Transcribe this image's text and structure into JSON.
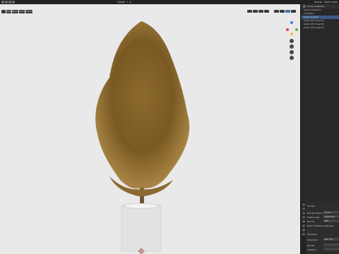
{
  "topbar": {
    "workspace_label": "Scene",
    "mode_label": "Object Mode",
    "right_label": "View Layer",
    "menu": [
      "File",
      "Edit",
      "Render",
      "Window",
      "Help"
    ]
  },
  "viewport": {
    "header_items": [
      "View",
      "Select",
      "Add",
      "Object"
    ],
    "shading_label": "Global"
  },
  "outliner": {
    "title": "Scene Collection",
    "rows": [
      {
        "label": "Scene Collection",
        "selected": false
      },
      {
        "label": "Collection",
        "selected": false
      },
      {
        "label": "Camera.plant",
        "selected": true
      },
      {
        "label": "plant_105_Flag_th1",
        "selected": false
      },
      {
        "label": "plant_105_Flag_th2",
        "selected": false
      },
      {
        "label": "plant_105_Flag_rnd",
        "selected": false
      }
    ]
  },
  "properties": {
    "section": "Format",
    "rows": [
      {
        "label": "Render Engine",
        "value": "Cycles"
      },
      {
        "label": "Feature Set",
        "value": "Supported"
      },
      {
        "label": "Device",
        "value": "GPU"
      },
      {
        "label": "Open Shading Language",
        "value": ""
      },
      {
        "label": "Sampling",
        "value": ""
      },
      {
        "label": "Integrator",
        "value": "Path Trac"
      },
      {
        "label": "Render",
        "value": ""
      },
      {
        "label": "Viewport",
        "value": ""
      }
    ]
  },
  "colors": {
    "viewport_bg": "#e9e9e9",
    "leaf_dark": "#6b4e1f",
    "leaf_light": "#a9803f",
    "pot": "#e2e2e2",
    "selection": "#3b5a84"
  }
}
